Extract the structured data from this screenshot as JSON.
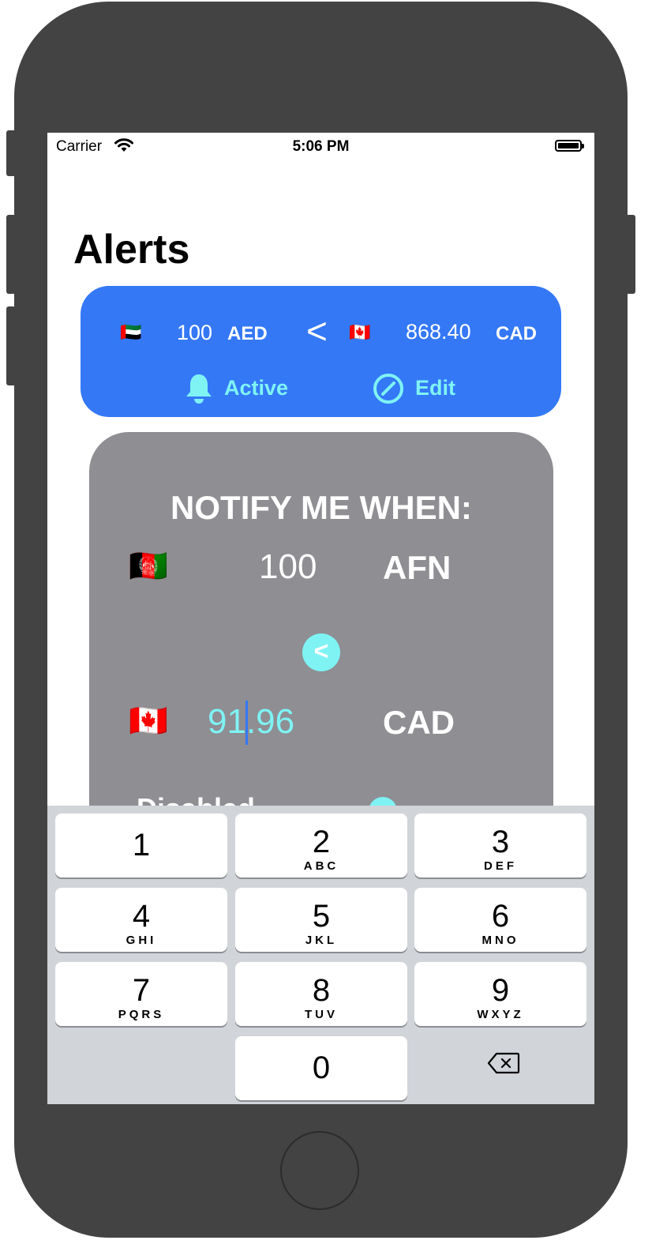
{
  "status_bar": {
    "carrier": "Carrier",
    "time": "5:06 PM",
    "icons": [
      "wifi-icon",
      "battery-icon"
    ]
  },
  "page": {
    "title": "Alerts"
  },
  "alert": {
    "from_flag": "🇦🇪",
    "from_amount": "100",
    "from_code": "AED",
    "comparison": "<",
    "to_flag": "🇨🇦",
    "to_amount": "868.40",
    "to_code": "CAD",
    "status_label": "Active",
    "status_icon": "bell-icon",
    "edit_label": "Edit",
    "edit_icon": "edit-circle-slash-icon"
  },
  "notify": {
    "heading": "NOTIFY ME WHEN:",
    "from_flag": "🇦🇫",
    "from_amount": "100",
    "from_code": "AFN",
    "comparison": "<",
    "to_flag": "🇨🇦",
    "to_amount": "91.96",
    "to_code": "CAD",
    "partial_row_text": "Disabled"
  },
  "keyboard": {
    "keys": [
      {
        "num": "1",
        "letters": ""
      },
      {
        "num": "2",
        "letters": "ABC"
      },
      {
        "num": "3",
        "letters": "DEF"
      },
      {
        "num": "4",
        "letters": "GHI"
      },
      {
        "num": "5",
        "letters": "JKL"
      },
      {
        "num": "6",
        "letters": "MNO"
      },
      {
        "num": "7",
        "letters": "PQRS"
      },
      {
        "num": "8",
        "letters": "TUV"
      },
      {
        "num": "9",
        "letters": "WXYZ"
      },
      {
        "num": "0",
        "letters": ""
      }
    ],
    "delete_icon": "backspace-icon"
  },
  "colors": {
    "accent_blue": "#3478f6",
    "accent_cyan": "#7ff3f4",
    "card_gray": "#8e8e93",
    "keyboard_bg": "#d1d4d9",
    "device": "#434343"
  }
}
